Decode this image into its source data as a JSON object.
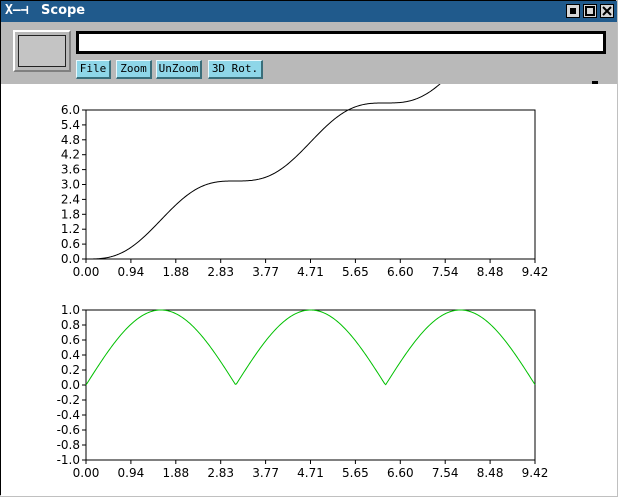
{
  "window": {
    "title": "Scope",
    "logo_glyph": "X–⊣",
    "controls": {
      "minimize_icon": "minimize-icon",
      "maximize_icon": "maximize-icon",
      "close_icon": "close-icon"
    },
    "titlebar_color": "#205a8c"
  },
  "toolbar": {
    "input_value": "",
    "buttons": {
      "file": "File",
      "zoom": "Zoom",
      "unzoom": "UnZoom",
      "rot3d": "3D Rot."
    },
    "button_color": "#8ed6e8"
  },
  "chart_data": [
    {
      "type": "line",
      "x_ticks": [
        "0.00",
        "0.94",
        "1.88",
        "2.83",
        "3.77",
        "4.71",
        "5.65",
        "6.60",
        "7.54",
        "8.48",
        "9.42"
      ],
      "y_ticks": [
        "6.0",
        "5.4",
        "4.8",
        "4.2",
        "3.6",
        "3.0",
        "2.4",
        "1.8",
        "1.2",
        "0.6",
        "0.0"
      ],
      "xlim": [
        0,
        9.42
      ],
      "ylim": [
        0,
        6.0
      ],
      "grid": false,
      "series": [
        {
          "color": "#000000",
          "function": "x - sin(x)*cos(x)",
          "x_range": [
            0,
            9.42
          ]
        }
      ]
    },
    {
      "type": "line",
      "x_ticks": [
        "0.00",
        "0.94",
        "1.88",
        "2.83",
        "3.77",
        "4.71",
        "5.65",
        "6.60",
        "7.54",
        "8.48",
        "9.42"
      ],
      "y_ticks": [
        "1.0",
        "0.8",
        "0.6",
        "0.4",
        "0.2",
        "0.0",
        "-0.2",
        "-0.4",
        "-0.6",
        "-0.8",
        "-1.0"
      ],
      "xlim": [
        0,
        9.42
      ],
      "ylim": [
        -1.0,
        1.0
      ],
      "grid": false,
      "series": [
        {
          "color": "#00c000",
          "function": "|sin(x)|",
          "x_range": [
            0,
            9.42
          ]
        }
      ]
    }
  ]
}
